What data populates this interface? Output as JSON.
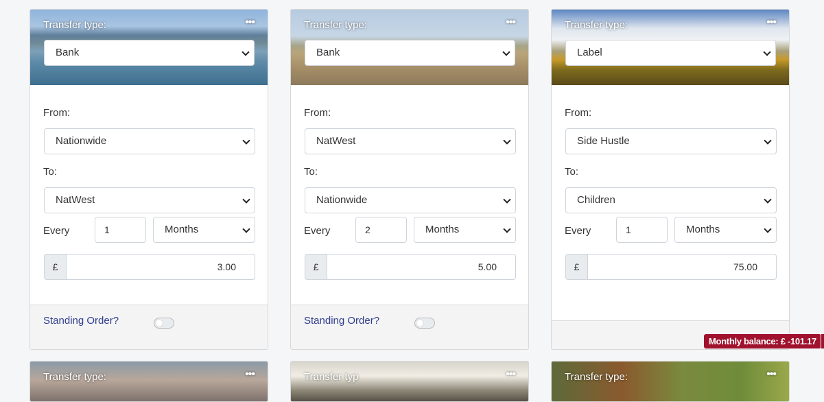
{
  "cards": [
    {
      "header_label": "Transfer type:",
      "menu_glyph": "•••",
      "transfer_type": "Bank",
      "from_label": "From:",
      "from_value": "Nationwide",
      "to_label": "To:",
      "to_value": "NatWest",
      "every_label": "Every",
      "every_value": "1",
      "period_value": "Months",
      "currency_symbol": "£",
      "amount": "3.00",
      "standing_order_label": "Standing Order?"
    },
    {
      "header_label": "Transfer type:",
      "menu_glyph": "•••",
      "transfer_type": "Bank",
      "from_label": "From:",
      "from_value": "NatWest",
      "to_label": "To:",
      "to_value": "Nationwide",
      "every_label": "Every",
      "every_value": "2",
      "period_value": "Months",
      "currency_symbol": "£",
      "amount": "5.00",
      "standing_order_label": "Standing Order?"
    },
    {
      "header_label": "Transfer type:",
      "menu_glyph": "•••",
      "transfer_type": "Label",
      "from_label": "From:",
      "from_value": "Side Hustle",
      "to_label": "To:",
      "to_value": "Children",
      "every_label": "Every",
      "every_value": "1",
      "period_value": "Months",
      "currency_symbol": "£",
      "amount": "75.00"
    }
  ],
  "row2_cards": [
    {
      "header_label": "Transfer type:",
      "menu_glyph": "•••"
    },
    {
      "header_label": "Transfer typ",
      "menu_glyph": "•••"
    },
    {
      "header_label": "Transfer type:",
      "menu_glyph": "•••"
    }
  ],
  "monthly_balance": {
    "label": "Monthly balance:",
    "value": "£ -101.17"
  },
  "colors": {
    "page_background": "#f5f6f8",
    "link": "#2f3d8f",
    "badge": "#a0112e"
  }
}
